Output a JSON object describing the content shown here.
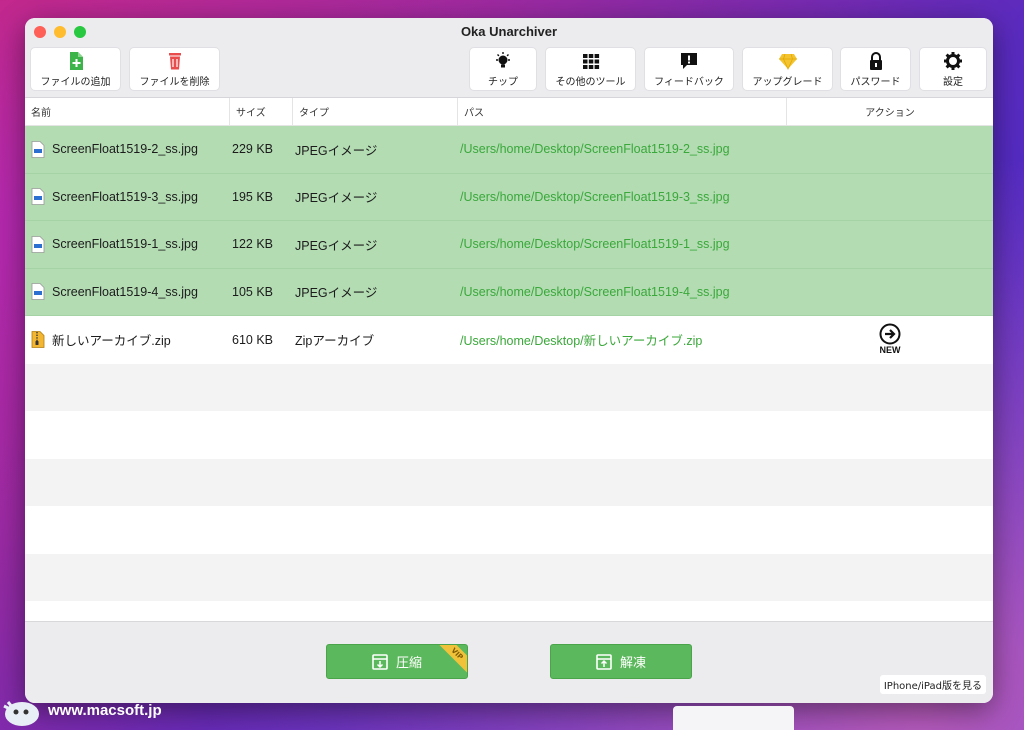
{
  "window": {
    "title": "Oka Unarchiver"
  },
  "toolbar": {
    "add_file": "ファイルの追加",
    "delete_file": "ファイルを削除",
    "tips": "チップ",
    "other_tools": "その他のツール",
    "feedback": "フィードバック",
    "upgrade": "アップグレード",
    "password": "パスワード",
    "settings": "設定"
  },
  "table": {
    "columns": {
      "name": "名前",
      "size": "サイズ",
      "type": "タイプ",
      "path": "パス",
      "action": "アクション"
    },
    "rows": [
      {
        "name": "ScreenFloat1519-2_ss.jpg",
        "size": "229 KB",
        "type": "JPEGイメージ",
        "path": "/Users/home/Desktop/ScreenFloat1519-2_ss.jpg"
      },
      {
        "name": "ScreenFloat1519-3_ss.jpg",
        "size": "195 KB",
        "type": "JPEGイメージ",
        "path": "/Users/home/Desktop/ScreenFloat1519-3_ss.jpg"
      },
      {
        "name": "ScreenFloat1519-1_ss.jpg",
        "size": "122 KB",
        "type": "JPEGイメージ",
        "path": "/Users/home/Desktop/ScreenFloat1519-1_ss.jpg"
      },
      {
        "name": "ScreenFloat1519-4_ss.jpg",
        "size": "105 KB",
        "type": "JPEGイメージ",
        "path": "/Users/home/Desktop/ScreenFloat1519-4_ss.jpg"
      },
      {
        "name": "新しいアーカイブ.zip",
        "size": "610 KB",
        "type": "Zipアーカイブ",
        "path": "/Users/home/Desktop/新しいアーカイブ.zip",
        "badge": "NEW"
      }
    ]
  },
  "bottom": {
    "compress": "圧縮",
    "vip_badge": "VIP",
    "extract": "解凍",
    "iphone_link": "IPhone/iPad版を見る"
  },
  "watermark": "www.macsoft.jp",
  "colors": {
    "selected_row": "#b3dcb3",
    "path_text": "#3aa83a",
    "action_button": "#5cb85c"
  }
}
